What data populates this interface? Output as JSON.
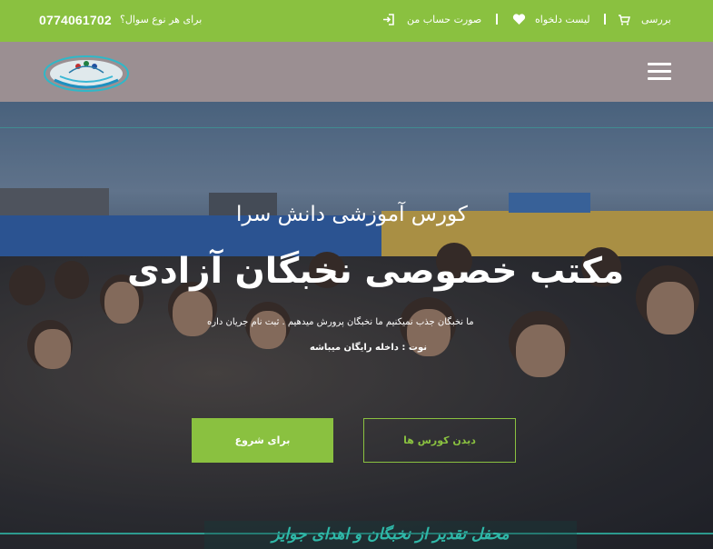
{
  "topbar": {
    "phone": "0774061702",
    "ask": "برای هر نوع سوال؟",
    "account": "صورت حساب من",
    "wishlist": "لیست دلخواه",
    "review": "بررسی"
  },
  "navbar": {
    "logo": "logo"
  },
  "hero": {
    "subtitle": "کورس آموزشی دانش سرا",
    "title": "مکتب خصوصی نخبگان آزادی",
    "description": "ما نخبگان جذب نمیکنیم ما نخبگان پرورش میدهیم . ثبت نام جریان داره",
    "note": "نوت : داخله رایگان میباشه",
    "start_button": "برای شروع",
    "courses_button": "دیدن کورس ها",
    "banner_text": "محفل تقدیر از نخبگان و اهدای جوایز"
  },
  "colors": {
    "accent": "#8ac140",
    "navbar": "#9b8f92",
    "teal": "#2fb8a8"
  },
  "icons": {
    "login": "sign-in-icon",
    "heart": "heart-icon",
    "cart": "cart-icon",
    "menu": "hamburger-icon"
  }
}
